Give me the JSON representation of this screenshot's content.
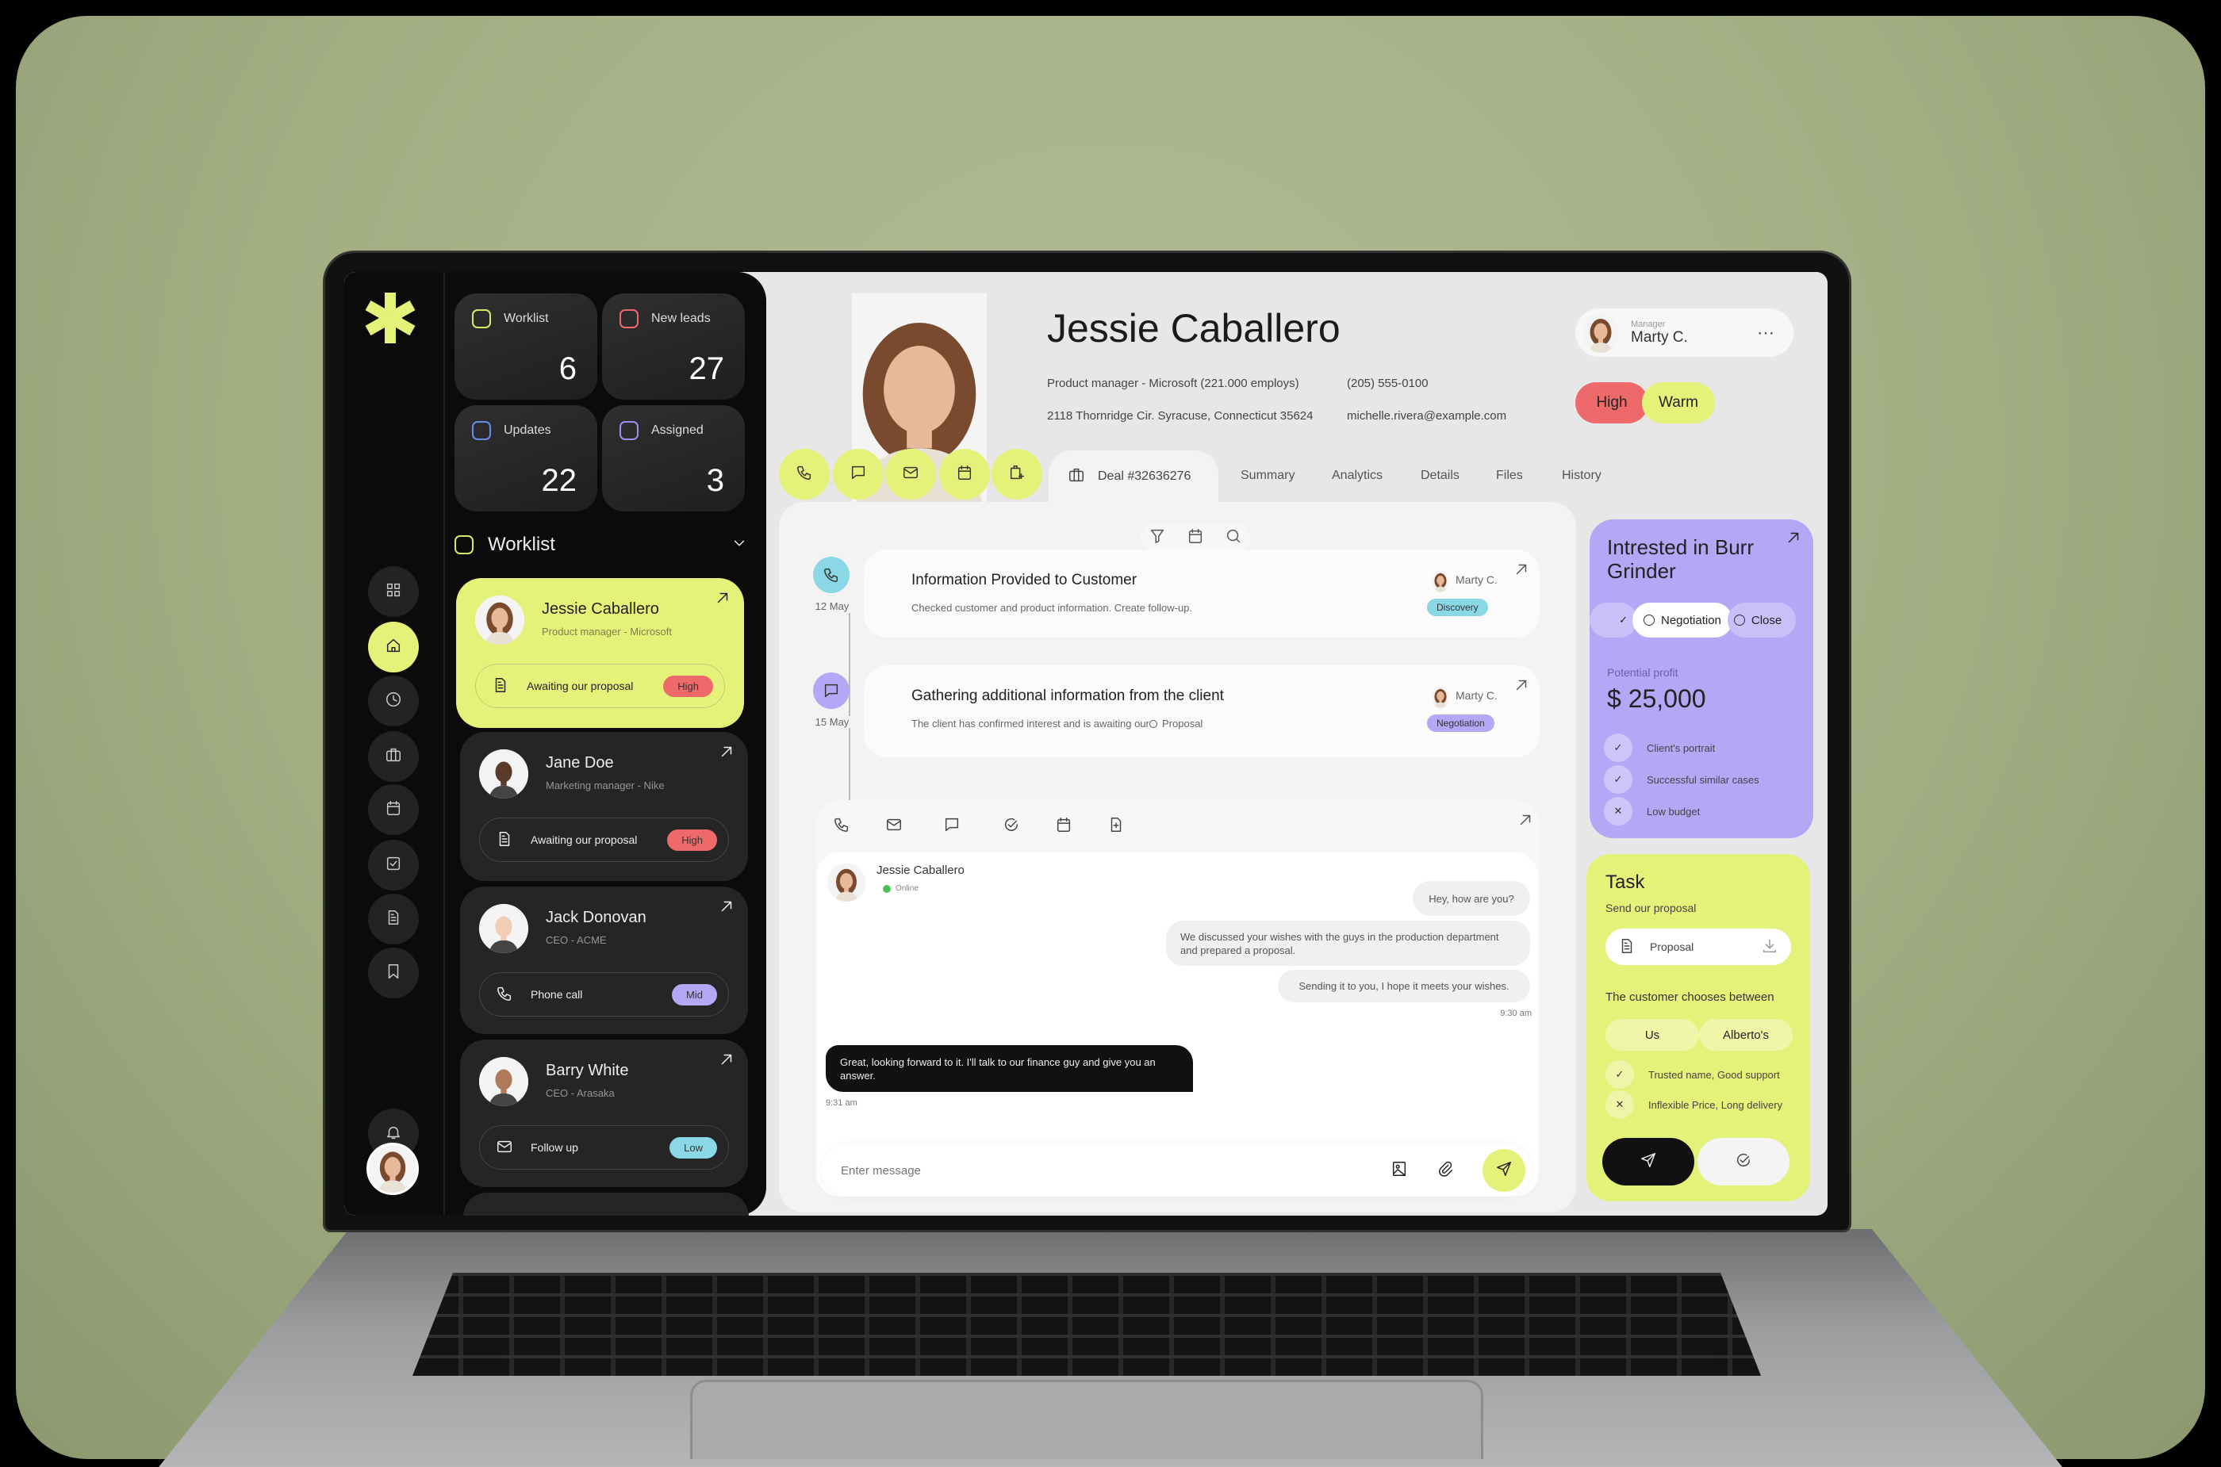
{
  "colors": {
    "accent": "#e4f27a",
    "high": "#ee6a6a",
    "mid": "#b3a8f5",
    "low": "#8ad8e6",
    "dark": "#0b0b0b"
  },
  "stats": [
    {
      "label": "Worklist",
      "value": "6",
      "color": "#d8e76a"
    },
    {
      "label": "New leads",
      "value": "27",
      "color": "#ee6a6a"
    },
    {
      "label": "Updates",
      "value": "22",
      "color": "#6a8bee"
    },
    {
      "label": "Assigned",
      "value": "3",
      "color": "#9d8ff0"
    }
  ],
  "worklist": {
    "title": "Worklist",
    "items": [
      {
        "name": "Jessie Caballero",
        "role": "Product manager - Microsoft",
        "task": "Awaiting our proposal",
        "task_icon": "document",
        "priority": "High"
      },
      {
        "name": "Jane Doe",
        "role": "Marketing manager - Nike",
        "task": "Awaiting our proposal",
        "task_icon": "document",
        "priority": "High"
      },
      {
        "name": "Jack Donovan",
        "role": "CEO - ACME",
        "task": "Phone call",
        "task_icon": "phone",
        "priority": "Mid"
      },
      {
        "name": "Barry White",
        "role": "CEO - Arasaka",
        "task": "Follow up",
        "task_icon": "mail",
        "priority": "Low"
      }
    ]
  },
  "rail": [
    "grid",
    "home",
    "clock",
    "briefcase",
    "calendar",
    "check-square",
    "document",
    "bookmark",
    "bell"
  ],
  "contact": {
    "name": "Jessie Caballero",
    "role": "Product manager - Microsoft (221.000 employs)",
    "phone": "(205) 555-0100",
    "address": "2118 Thornridge Cir. Syracuse, Connecticut 35624",
    "email": "michelle.rivera@example.com",
    "tags": [
      "High",
      "Warm"
    ]
  },
  "manager": {
    "label": "Manager",
    "name": "Marty C."
  },
  "tabs": {
    "deal": "Deal #32636276",
    "items": [
      "Summary",
      "Analytics",
      "Details",
      "Files",
      "History"
    ]
  },
  "timeline": [
    {
      "date": "12 May",
      "title": "Information Provided to Customer",
      "desc": "Checked customer and product information. Create follow-up.",
      "owner": "Marty C.",
      "stage": "Discovery",
      "attachment": ""
    },
    {
      "date": "15 May",
      "title": "Gathering additional information from the client",
      "desc": "The client has confirmed interest and is awaiting our",
      "owner": "Marty C.",
      "stage": "Negotiation",
      "attachment": "Proposal"
    }
  ],
  "chat": {
    "contact": "Jessie Caballero",
    "status": "Online",
    "outgoing": [
      "Hey, how are you?",
      "We discussed your wishes with the guys in the production department and prepared a proposal.",
      "Sending it to you, I hope it meets your wishes."
    ],
    "outgoing_time": "9:30 am",
    "incoming": "Great, looking forward to it. I'll talk to our finance guy and give you an answer.",
    "incoming_time": "9:31 am",
    "placeholder": "Enter message"
  },
  "deal_card": {
    "title": "Intrested in Burr Grinder",
    "stages": [
      "Negotiation",
      "Close"
    ],
    "profit_label": "Potential profit",
    "profit": "$ 25,000",
    "checks": [
      {
        "text": "Client's portrait",
        "ok": true
      },
      {
        "text": "Successful similar cases",
        "ok": true
      },
      {
        "text": "Low budget",
        "ok": false
      }
    ]
  },
  "task": {
    "title": "Task",
    "subtitle": "Send our proposal",
    "file": "Proposal",
    "choose_label": "The customer chooses between",
    "options": [
      "Us",
      "Alberto's"
    ],
    "checks": [
      {
        "text": "Trusted name, Good support",
        "ok": true
      },
      {
        "text": "Inflexible Price, Long delivery",
        "ok": false
      }
    ]
  }
}
